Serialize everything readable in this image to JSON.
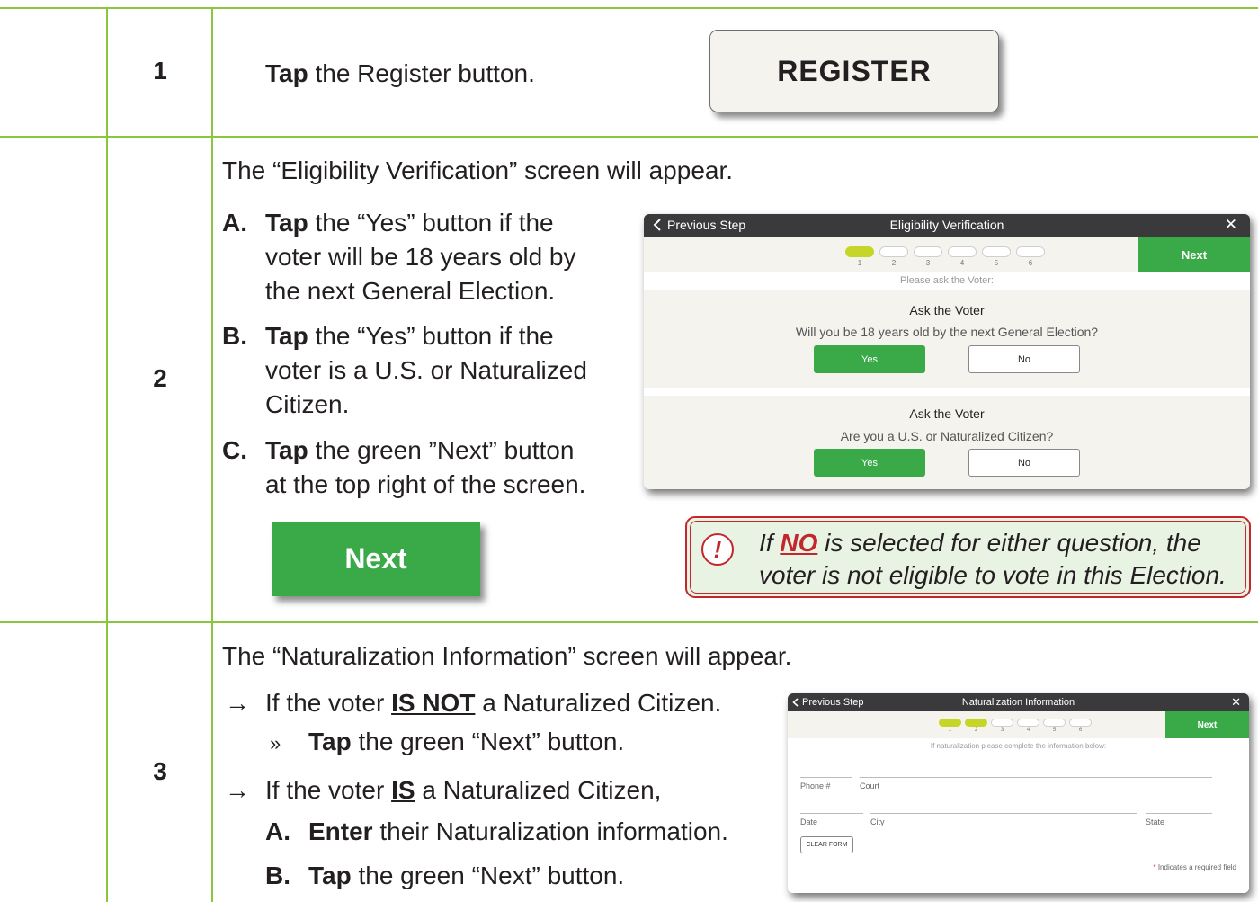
{
  "rows": [
    {
      "number": "1"
    },
    {
      "number": "2"
    },
    {
      "number": "3"
    }
  ],
  "step1": {
    "text_bold": "Tap",
    "text_rest": " the Register button.",
    "register_button": "REGISTER"
  },
  "step2": {
    "intro": "The “Eligibility Verification” screen will appear.",
    "items": [
      {
        "letter": "A.",
        "bold": "Tap",
        "line1": " the “Yes” button if the",
        "line2": "voter will be 18 years old by",
        "line3": "the next General Election."
      },
      {
        "letter": "B.",
        "bold": "Tap",
        "line1": " the “Yes” button if the",
        "line2": "voter is a U.S. or Naturalized",
        "line3": "Citizen."
      },
      {
        "letter": "C.",
        "bold": "Tap",
        "line1": " the green ”Next” button",
        "line2": "at the top right of the screen."
      }
    ],
    "next_button": "Next",
    "warning": {
      "icon": "exclamation-icon",
      "pre": "If ",
      "no": "NO",
      "line1_rest": " is selected for either question, the",
      "line2": "voter is not eligible to vote in this Election."
    },
    "app": {
      "prev": "Previous Step",
      "title": "Eligibility Verification",
      "close": "✕",
      "steps": [
        "1",
        "2",
        "3",
        "4",
        "5",
        "6"
      ],
      "active_steps": 1,
      "next": "Next",
      "prompt": "Please ask the Voter:",
      "questions": [
        {
          "heading": "Ask the Voter",
          "question": "Will you be 18 years old by the next General Election?",
          "yes": "Yes",
          "no": "No"
        },
        {
          "heading": "Ask the Voter",
          "question": "Are you a U.S. or Naturalized Citizen?",
          "yes": "Yes",
          "no": "No"
        }
      ]
    }
  },
  "step3": {
    "intro": "The “Naturalization Information” screen will appear.",
    "arrow": "→",
    "case1_pre": "If the voter ",
    "case1_em": "IS NOT",
    "case1_post": " a Naturalized Citizen.",
    "case1_bullet": "»",
    "case1_bold": "Tap",
    "case1_rest": " the green “Next” button.",
    "case2_pre": "If the voter ",
    "case2_em": "IS",
    "case2_post": " a Naturalized Citizen,",
    "sub_a_letter": "A.",
    "sub_a_bold": "Enter",
    "sub_a_rest": " their Naturalization information.",
    "sub_b_letter": "B.",
    "sub_b_bold": "Tap",
    "sub_b_rest": " the green “Next” button.",
    "app": {
      "prev": "Previous Step",
      "title": "Naturalization Information",
      "close": "✕",
      "steps": [
        "1",
        "2",
        "3",
        "4",
        "5",
        "6"
      ],
      "active_steps": 2,
      "next": "Next",
      "prompt": "If naturalization please complete the information below:",
      "fields": {
        "phone": "Phone #",
        "court": "Court",
        "date": "Date",
        "city": "City",
        "state": "State"
      },
      "clear": "CLEAR FORM",
      "required_star": "*",
      "required": " Indicates a required field"
    }
  }
}
